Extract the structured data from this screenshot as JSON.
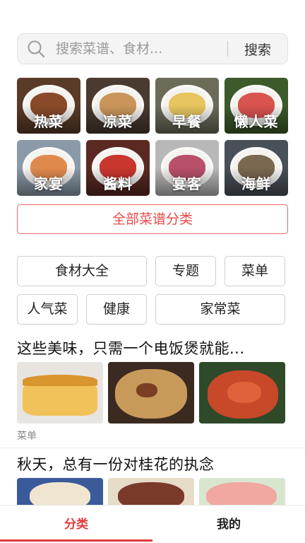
{
  "search": {
    "placeholder": "搜索菜谱、食材...",
    "button_label": "搜索"
  },
  "categories": [
    {
      "label": "热菜",
      "bg": "#5a3b28",
      "food": "#8a4a2a"
    },
    {
      "label": "凉菜",
      "bg": "#4a3a30",
      "food": "#c9955a"
    },
    {
      "label": "早餐",
      "bg": "#6b6b58",
      "food": "#e6c45e"
    },
    {
      "label": "懒人菜",
      "bg": "#3d5a2a",
      "food": "#d9534f"
    },
    {
      "label": "家宴",
      "bg": "#8a9aa8",
      "food": "#e0894d"
    },
    {
      "label": "酱料",
      "bg": "#5a2a22",
      "food": "#c8362e"
    },
    {
      "label": "宴客",
      "bg": "#b8b8b8",
      "food": "#b8506a"
    },
    {
      "label": "海鲜",
      "bg": "#4a5058",
      "food": "#7a6850"
    }
  ],
  "all_categories_label": "全部菜谱分类",
  "tags": [
    {
      "label": "食材大全"
    },
    {
      "label": "专题"
    },
    {
      "label": "菜单"
    },
    {
      "label": "人气菜"
    },
    {
      "label": "健康"
    },
    {
      "label": "家常菜"
    }
  ],
  "articles": [
    {
      "title": "这些美味，只需一个电饭煲就能...",
      "tag": "菜单"
    },
    {
      "title": "秋天，总有一份对桂花的执念",
      "tag": ""
    }
  ],
  "bottom_nav": [
    {
      "label": "分类",
      "active": true
    },
    {
      "label": "我的",
      "active": false
    }
  ],
  "colors": {
    "accent": "#e3393c",
    "border": "#cfcfcf"
  }
}
